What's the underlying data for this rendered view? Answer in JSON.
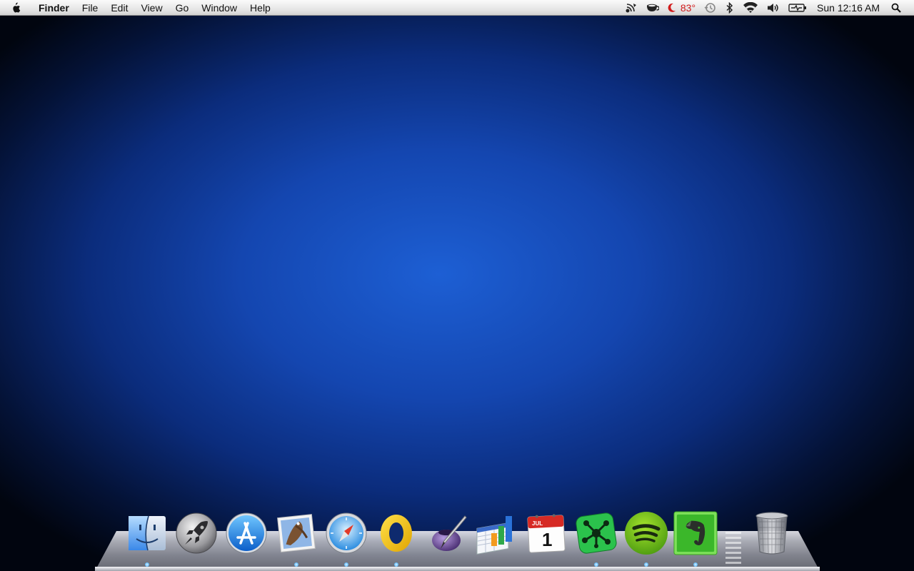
{
  "menubar": {
    "apple_icon": "apple-logo-icon",
    "app_name": "Finder",
    "menus": [
      "File",
      "Edit",
      "View",
      "Go",
      "Window",
      "Help"
    ],
    "status": {
      "weather_temp": "83°",
      "clock": "Sun 12:16 AM"
    }
  },
  "dock": {
    "apps": [
      {
        "name": "Finder",
        "icon": "finder-icon",
        "running": true
      },
      {
        "name": "Launchpad",
        "icon": "launchpad-icon",
        "running": false
      },
      {
        "name": "App Store",
        "icon": "app-store-icon",
        "running": false
      },
      {
        "name": "Mail",
        "icon": "mail-icon",
        "running": true
      },
      {
        "name": "Safari",
        "icon": "safari-icon",
        "running": true
      },
      {
        "name": "Microsoft Outlook",
        "icon": "outlook-icon",
        "running": true
      },
      {
        "name": "Quill",
        "icon": "quill-icon",
        "running": false
      },
      {
        "name": "Numbers",
        "icon": "numbers-icon",
        "running": false
      },
      {
        "name": "Calendar",
        "icon": "calendar-icon",
        "running": false,
        "month": "JUL",
        "day": "1"
      },
      {
        "name": "Mind map app",
        "icon": "mindmap-icon",
        "running": true
      },
      {
        "name": "Spotify",
        "icon": "spotify-icon",
        "running": true
      },
      {
        "name": "Evernote",
        "icon": "evernote-icon",
        "running": true
      }
    ],
    "trash": {
      "name": "Trash",
      "icon": "trash-icon"
    }
  },
  "colors": {
    "wallpaper_center": "#1d5fd4",
    "wallpaper_edge": "#01050f",
    "temp_red": "#d11b1b"
  }
}
